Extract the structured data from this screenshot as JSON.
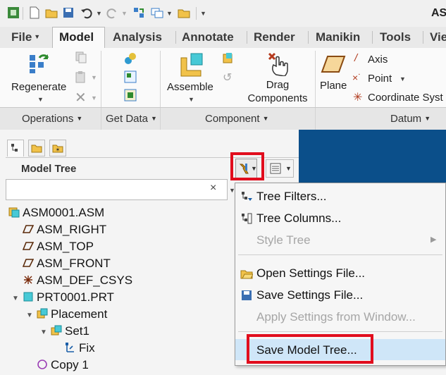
{
  "window": {
    "title": "AS"
  },
  "ribbon_tabs": [
    {
      "label": "File"
    },
    {
      "label": "Model"
    },
    {
      "label": "Analysis"
    },
    {
      "label": "Annotate"
    },
    {
      "label": "Render"
    },
    {
      "label": "Manikin"
    },
    {
      "label": "Tools"
    },
    {
      "label": "Vie"
    }
  ],
  "ribbon": {
    "regenerate": "Regenerate",
    "assemble": "Assemble",
    "drag_components_line1": "Drag",
    "drag_components_line2": "Components",
    "plane": "Plane",
    "axis": "Axis",
    "point": "Point",
    "coordinate_system": "Coordinate Syst"
  },
  "groups": [
    {
      "label": "Operations"
    },
    {
      "label": "Get Data"
    },
    {
      "label": "Component"
    },
    {
      "label": "Datum"
    }
  ],
  "model_tree": {
    "title": "Model Tree",
    "search_value": "",
    "clear_symbol": "×",
    "items": [
      {
        "label": "ASM0001.ASM"
      },
      {
        "label": "ASM_RIGHT"
      },
      {
        "label": "ASM_TOP"
      },
      {
        "label": "ASM_FRONT"
      },
      {
        "label": "ASM_DEF_CSYS"
      },
      {
        "label": "PRT0001.PRT"
      },
      {
        "label": "Placement"
      },
      {
        "label": "Set1"
      },
      {
        "label": "Fix"
      },
      {
        "label": "Copy 1"
      }
    ]
  },
  "settings_menu": {
    "items": [
      {
        "label": "Tree Filters...",
        "enabled": true
      },
      {
        "label": "Tree Columns...",
        "enabled": true
      },
      {
        "label": "Style Tree",
        "enabled": false
      },
      {
        "label": "Open Settings File...",
        "enabled": true
      },
      {
        "label": "Save Settings File...",
        "enabled": true
      },
      {
        "label": "Apply Settings from Window...",
        "enabled": false
      },
      {
        "label": "Save Model Tree...",
        "enabled": true,
        "highlighted": true
      }
    ]
  },
  "colors": {
    "highlight_box": "#e10d1d",
    "menu_hover": "#cfe6f8",
    "graphics_bg": "#0b4f8a"
  }
}
